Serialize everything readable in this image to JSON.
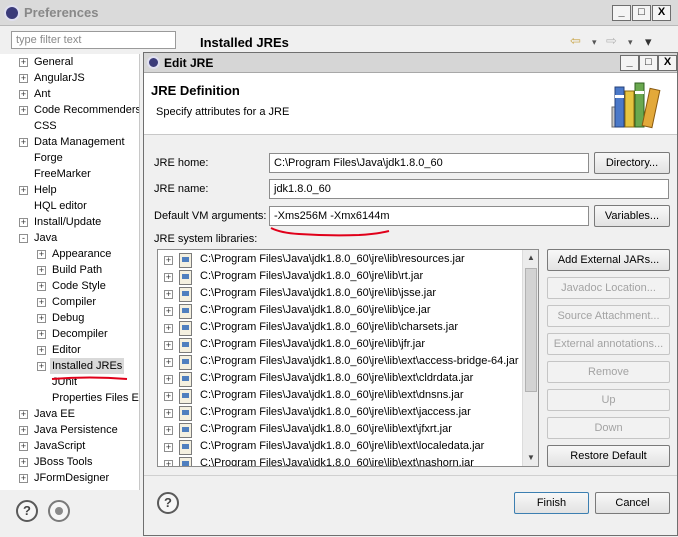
{
  "prefs": {
    "title": "Preferences",
    "filter_placeholder": "type filter text",
    "page_title": "Installed JREs",
    "window_controls": [
      "_",
      "□",
      "X"
    ],
    "tree": [
      {
        "label": "General",
        "expander": "+",
        "depth": 0
      },
      {
        "label": "AngularJS",
        "expander": "+",
        "depth": 0
      },
      {
        "label": "Ant",
        "expander": "+",
        "depth": 0
      },
      {
        "label": "Code Recommenders",
        "expander": "+",
        "depth": 0
      },
      {
        "label": "CSS",
        "expander": "",
        "depth": 0
      },
      {
        "label": "Data Management",
        "expander": "+",
        "depth": 0
      },
      {
        "label": "Forge",
        "expander": "",
        "depth": 0
      },
      {
        "label": "FreeMarker",
        "expander": "",
        "depth": 0
      },
      {
        "label": "Help",
        "expander": "+",
        "depth": 0
      },
      {
        "label": "HQL editor",
        "expander": "",
        "depth": 0
      },
      {
        "label": "Install/Update",
        "expander": "+",
        "depth": 0
      },
      {
        "label": "Java",
        "expander": "-",
        "depth": 0
      },
      {
        "label": "Appearance",
        "expander": "+",
        "depth": 1
      },
      {
        "label": "Build Path",
        "expander": "+",
        "depth": 1
      },
      {
        "label": "Code Style",
        "expander": "+",
        "depth": 1
      },
      {
        "label": "Compiler",
        "expander": "+",
        "depth": 1
      },
      {
        "label": "Debug",
        "expander": "+",
        "depth": 1
      },
      {
        "label": "Decompiler",
        "expander": "+",
        "depth": 1
      },
      {
        "label": "Editor",
        "expander": "+",
        "depth": 1
      },
      {
        "label": "Installed JREs",
        "expander": "+",
        "depth": 1,
        "selected": true
      },
      {
        "label": "JUnit",
        "expander": "",
        "depth": 1
      },
      {
        "label": "Properties Files Ed",
        "expander": "",
        "depth": 1
      },
      {
        "label": "Java EE",
        "expander": "+",
        "depth": 0
      },
      {
        "label": "Java Persistence",
        "expander": "+",
        "depth": 0
      },
      {
        "label": "JavaScript",
        "expander": "+",
        "depth": 0
      },
      {
        "label": "JBoss Tools",
        "expander": "+",
        "depth": 0
      },
      {
        "label": "JFormDesigner",
        "expander": "+",
        "depth": 0
      }
    ],
    "help_icon": "?",
    "nav_back_icon": "⇦",
    "nav_forward_icon": "⇨",
    "nav_menu_icon": "▾"
  },
  "dialog": {
    "title": "Edit JRE",
    "window_controls": [
      "_",
      "□",
      "X"
    ],
    "header_title": "JRE Definition",
    "header_subtitle": "Specify attributes for a JRE",
    "fields": {
      "jre_home_label": "JRE home:",
      "jre_home_value": "C:\\Program Files\\Java\\jdk1.8.0_60",
      "jre_name_label": "JRE name:",
      "jre_name_value": "jdk1.8.0_60",
      "vm_args_label": "Default VM arguments:",
      "vm_args_value": "-Xms256M -Xmx6144m",
      "libraries_label": "JRE system libraries:"
    },
    "buttons": {
      "directory": "Directory...",
      "variables": "Variables...",
      "add_external_jars": "Add External JARs...",
      "javadoc_location": "Javadoc Location...",
      "source_attachment": "Source Attachment...",
      "external_annotations": "External annotations...",
      "remove": "Remove",
      "up": "Up",
      "down": "Down",
      "restore_default": "Restore Default",
      "finish": "Finish",
      "cancel": "Cancel"
    },
    "libraries": [
      "C:\\Program Files\\Java\\jdk1.8.0_60\\jre\\lib\\resources.jar",
      "C:\\Program Files\\Java\\jdk1.8.0_60\\jre\\lib\\rt.jar",
      "C:\\Program Files\\Java\\jdk1.8.0_60\\jre\\lib\\jsse.jar",
      "C:\\Program Files\\Java\\jdk1.8.0_60\\jre\\lib\\jce.jar",
      "C:\\Program Files\\Java\\jdk1.8.0_60\\jre\\lib\\charsets.jar",
      "C:\\Program Files\\Java\\jdk1.8.0_60\\jre\\lib\\jfr.jar",
      "C:\\Program Files\\Java\\jdk1.8.0_60\\jre\\lib\\ext\\access-bridge-64.jar",
      "C:\\Program Files\\Java\\jdk1.8.0_60\\jre\\lib\\ext\\cldrdata.jar",
      "C:\\Program Files\\Java\\jdk1.8.0_60\\jre\\lib\\ext\\dnsns.jar",
      "C:\\Program Files\\Java\\jdk1.8.0_60\\jre\\lib\\ext\\jaccess.jar",
      "C:\\Program Files\\Java\\jdk1.8.0_60\\jre\\lib\\ext\\jfxrt.jar",
      "C:\\Program Files\\Java\\jdk1.8.0_60\\jre\\lib\\ext\\localedata.jar",
      "C:\\Program Files\\Java\\jdk1.8.0_60\\jre\\lib\\ext\\nashorn.jar"
    ],
    "library_expander": "+",
    "help_icon": "?"
  },
  "colors": {
    "annotation_red": "#e0001a",
    "selection_gray": "#d9d9d9"
  }
}
